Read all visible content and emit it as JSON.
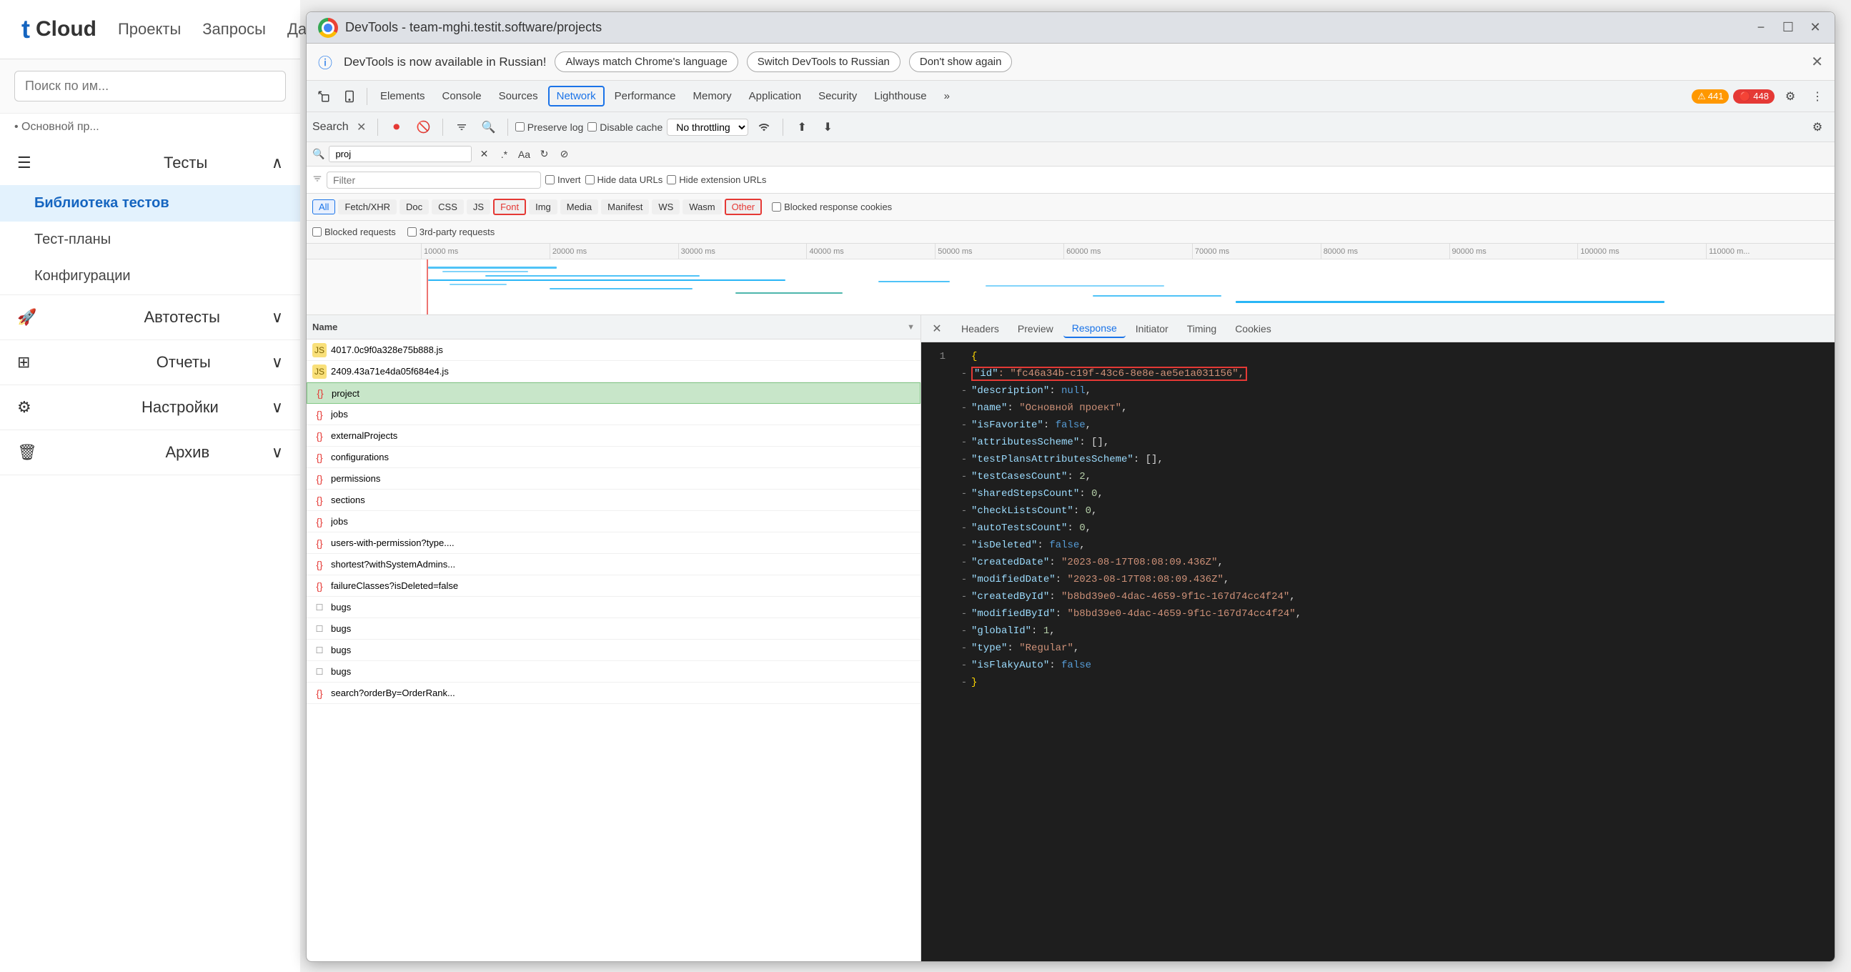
{
  "app": {
    "logo_t": "t",
    "logo_cloud": "Cloud",
    "nav": [
      "Проекты",
      "Запросы",
      "Дашб..."
    ]
  },
  "sidebar": {
    "sections": [
      {
        "icon": "☰",
        "label": "Тесты",
        "expanded": true,
        "items": [
          {
            "label": "Библиотека тестов",
            "active": true
          },
          {
            "label": "Тест-планы",
            "active": false
          },
          {
            "label": "Конфигурации",
            "active": false
          }
        ]
      },
      {
        "icon": "🚀",
        "label": "Автотесты",
        "expanded": false,
        "items": []
      },
      {
        "icon": "⊞",
        "label": "Отчеты",
        "expanded": false,
        "items": []
      },
      {
        "icon": "⚙",
        "label": "Настройки",
        "expanded": false,
        "items": []
      },
      {
        "icon": "🗑",
        "label": "Архив",
        "expanded": false,
        "items": []
      }
    ],
    "search_placeholder": "Поиск по им...",
    "breadcrumb": "• Основной пр..."
  },
  "devtools": {
    "title": "DevTools - team-mghi.testit.software/projects",
    "notification": {
      "text": "DevTools is now available in Russian!",
      "btn1": "Always match Chrome's language",
      "btn2": "Switch DevTools to Russian",
      "btn3": "Don't show again"
    },
    "toolbar_tabs": [
      "Elements",
      "Console",
      "Sources",
      "Network",
      "Performance",
      "Memory",
      "Application",
      "Security",
      "Lighthouse",
      "»"
    ],
    "warnings": "441",
    "errors": "448",
    "network_toolbar": {
      "search_label": "Search",
      "preserve": "Preserve log",
      "disable_cache": "Disable cache",
      "throttling": "No throttling",
      "filter_placeholder": "Filter",
      "invert": "Invert",
      "hide_data": "Hide data URLs",
      "hide_ext": "Hide extension URLs"
    },
    "type_filters": [
      "All",
      "Fetch/XHR",
      "Doc",
      "CSS",
      "JS",
      "Font",
      "Img",
      "Media",
      "Manifest",
      "WS",
      "Wasm",
      "Other"
    ],
    "blocked_cookies": "Blocked response cookies",
    "request_filters": [
      "Blocked requests",
      "3rd-party requests"
    ],
    "timeline": {
      "marks": [
        "10000 ms",
        "20000 ms",
        "30000 ms",
        "40000 ms",
        "50000 ms",
        "60000 ms",
        "70000 ms",
        "80000 ms",
        "90000 ms",
        "100000 ms",
        "110000 m..."
      ]
    },
    "network_list": {
      "col_name": "Name",
      "rows": [
        {
          "icon": "js",
          "name": "4017.0c9f0a328e75b888.js",
          "type": "js"
        },
        {
          "icon": "js",
          "name": "2409.43a71e4da05f684e4.js",
          "type": "js"
        },
        {
          "icon": "api",
          "name": "project",
          "type": "api",
          "active": true
        },
        {
          "icon": "api",
          "name": "jobs",
          "type": "api"
        },
        {
          "icon": "api",
          "name": "externalProjects",
          "type": "api"
        },
        {
          "icon": "api",
          "name": "configurations",
          "type": "api"
        },
        {
          "icon": "api",
          "name": "permissions",
          "type": "api"
        },
        {
          "icon": "api",
          "name": "sections",
          "type": "api"
        },
        {
          "icon": "api",
          "name": "jobs",
          "type": "api"
        },
        {
          "icon": "api",
          "name": "users-with-permission?type....",
          "type": "api"
        },
        {
          "icon": "api",
          "name": "shortest?withSystemAdmins...",
          "type": "api"
        },
        {
          "icon": "api",
          "name": "failureClasses?isDeleted=false",
          "type": "api"
        },
        {
          "icon": "file",
          "name": "bugs",
          "type": "file"
        },
        {
          "icon": "file",
          "name": "bugs",
          "type": "file"
        },
        {
          "icon": "file",
          "name": "bugs",
          "type": "file"
        },
        {
          "icon": "file",
          "name": "bugs",
          "type": "file"
        },
        {
          "icon": "api",
          "name": "search?orderBy=OrderRank...",
          "type": "api"
        }
      ]
    },
    "detail": {
      "tabs": [
        "Headers",
        "Preview",
        "Response",
        "Initiator",
        "Timing",
        "Cookies"
      ],
      "active_tab": "Response",
      "json_lines": [
        {
          "num": "1",
          "arrow": "",
          "content": "{",
          "type": "brace"
        },
        {
          "num": "",
          "arrow": "-",
          "content_key": "\"id\"",
          "content_val": "\"fc46a34b-c19f-43c6-8e8e-ae5e1a031156\"",
          "highlight": true
        },
        {
          "num": "",
          "arrow": "-",
          "content_key": "\"description\"",
          "content_val": "null"
        },
        {
          "num": "",
          "arrow": "-",
          "content_key": "\"name\"",
          "content_val": "\"Основной проект\""
        },
        {
          "num": "",
          "arrow": "-",
          "content_key": "\"isFavorite\"",
          "content_val": "false"
        },
        {
          "num": "",
          "arrow": "-",
          "content_key": "\"attributesScheme\"",
          "content_val": "[]"
        },
        {
          "num": "",
          "arrow": "-",
          "content_key": "\"testPlansAttributesScheme\"",
          "content_val": "[]"
        },
        {
          "num": "",
          "arrow": "-",
          "content_key": "\"testCasesCount\"",
          "content_val": "2"
        },
        {
          "num": "",
          "arrow": "-",
          "content_key": "\"sharedStepsCount\"",
          "content_val": "0"
        },
        {
          "num": "",
          "arrow": "-",
          "content_key": "\"checkListsCount\"",
          "content_val": "0"
        },
        {
          "num": "",
          "arrow": "-",
          "content_key": "\"autoTestsCount\"",
          "content_val": "0"
        },
        {
          "num": "",
          "arrow": "-",
          "content_key": "\"isDeleted\"",
          "content_val": "false"
        },
        {
          "num": "",
          "arrow": "-",
          "content_key": "\"createdDate\"",
          "content_val": "\"2023-08-17T08:08:09.436Z\""
        },
        {
          "num": "",
          "arrow": "-",
          "content_key": "\"modifiedDate\"",
          "content_val": "\"2023-08-17T08:08:09.436Z\""
        },
        {
          "num": "",
          "arrow": "-",
          "content_key": "\"createdById\"",
          "content_val": "\"b8bd39e0-4dac-4659-9f1c-167d74cc4f24\""
        },
        {
          "num": "",
          "arrow": "-",
          "content_key": "\"modifiedById\"",
          "content_val": "\"b8bd39e0-4dac-4659-9f1c-167d74cc4f24\""
        },
        {
          "num": "",
          "arrow": "-",
          "content_key": "\"globalId\"",
          "content_val": "1"
        },
        {
          "num": "",
          "arrow": "-",
          "content_key": "\"type\"",
          "content_val": "\"Regular\""
        },
        {
          "num": "",
          "arrow": "-",
          "content_key": "\"isFlakyAuto\"",
          "content_val": "false"
        },
        {
          "num": "",
          "arrow": "-",
          "content": "}",
          "type": "brace"
        }
      ]
    }
  }
}
